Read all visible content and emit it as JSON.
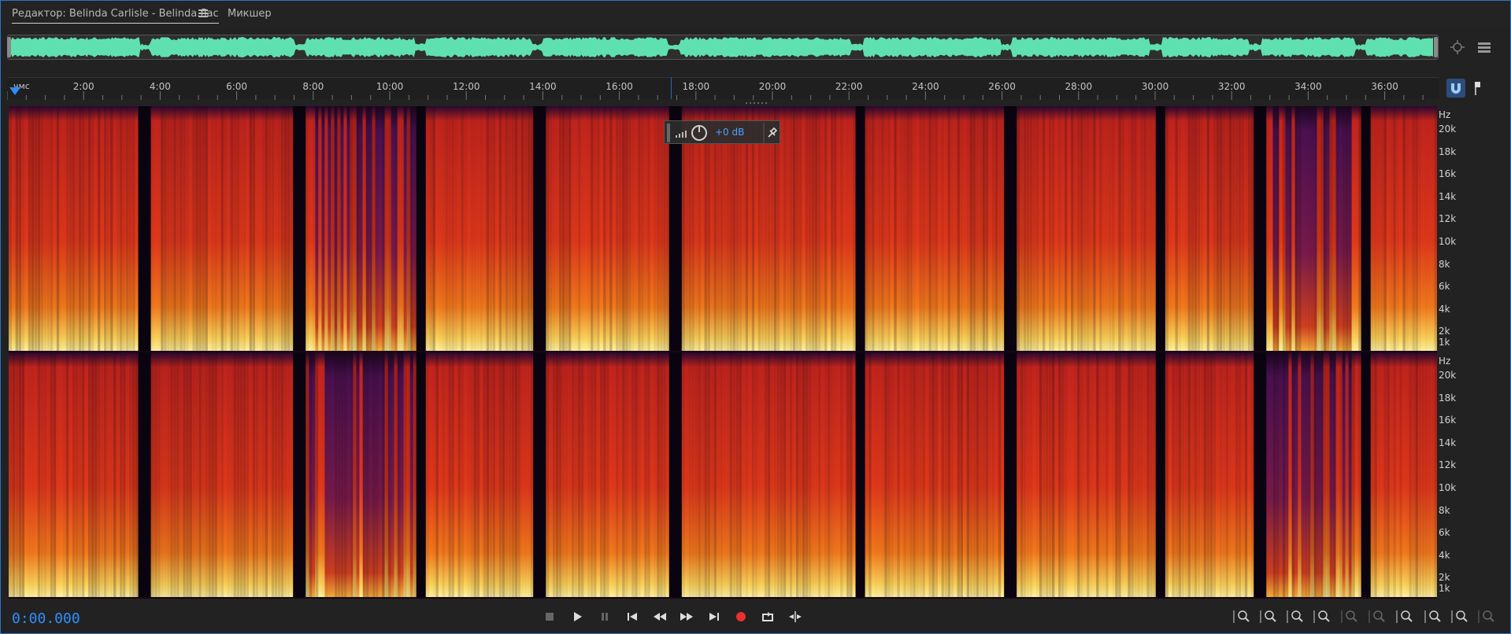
{
  "tabs": {
    "editor": "Редактор: Belinda Carlisle - Belinda.flac",
    "mixer": "Микшер"
  },
  "ruler": {
    "unit": "чмс",
    "labels": [
      "2:00",
      "4:00",
      "6:00",
      "8:00",
      "10:00",
      "12:00",
      "14:00",
      "16:00",
      "18:00",
      "20:00",
      "22:00",
      "24:00",
      "26:00",
      "28:00",
      "30:00",
      "32:00",
      "34:00",
      "36:00"
    ]
  },
  "hud": {
    "gain": "+0 dB"
  },
  "frequency_axis": {
    "unit": "Hz",
    "labels": [
      "20k",
      "18k",
      "16k",
      "14k",
      "12k",
      "10k",
      "8k",
      "6k",
      "4k",
      "2k",
      "1k"
    ]
  },
  "transport": {
    "current_time": "0:00.000",
    "buttons": [
      "stop",
      "play",
      "pause",
      "go-to-start",
      "rewind",
      "fast-forward",
      "go-to-end",
      "record",
      "loop",
      "skip-selection"
    ]
  },
  "colors": {
    "accent": "#2f8fff",
    "waveform": "#5fe0b0",
    "record": "#e8312f"
  }
}
